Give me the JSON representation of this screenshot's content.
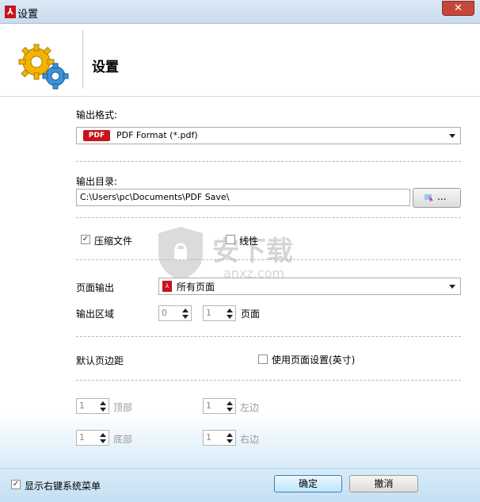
{
  "window": {
    "title": "设置",
    "close_icon": "close-icon",
    "app_icon": "pdf-app-icon"
  },
  "header": {
    "title": "设置",
    "icon": "gears-icon"
  },
  "output_format": {
    "label": "输出格式:",
    "badge": "PDF",
    "value": "PDF Format (*.pdf)"
  },
  "output_dir": {
    "label": "输出目录:",
    "value": "C:\\Users\\pc\\Documents\\PDF Save\\",
    "browse_label": "..."
  },
  "options": {
    "compress_label": "压缩文件",
    "compress_checked": true,
    "linear_label": "线性",
    "linear_checked": false
  },
  "page_output": {
    "label": "页面输出",
    "value": "所有页面"
  },
  "output_range": {
    "label": "输出区域",
    "from": "0",
    "to": "1",
    "unit": "页面"
  },
  "margins": {
    "label": "默认页边距",
    "use_page_settings_label": "使用页面设置(英寸)",
    "use_page_settings_checked": false,
    "top_value": "1",
    "top_label": "顶部",
    "left_value": "1",
    "left_label": "左边",
    "bottom_value": "1",
    "bottom_label": "底部",
    "right_value": "1",
    "right_label": "右边"
  },
  "footer": {
    "context_menu_label": "显示右键系统菜单",
    "context_menu_checked": true,
    "ok_label": "确定",
    "cancel_label": "撤消"
  },
  "watermark": {
    "text": "安下载",
    "subtext": "anxz.com"
  },
  "colors": {
    "accent_red": "#c8141b",
    "title_bar": "#dbe8f5",
    "close": "#c7463a",
    "footer": "#c4e0f3"
  }
}
